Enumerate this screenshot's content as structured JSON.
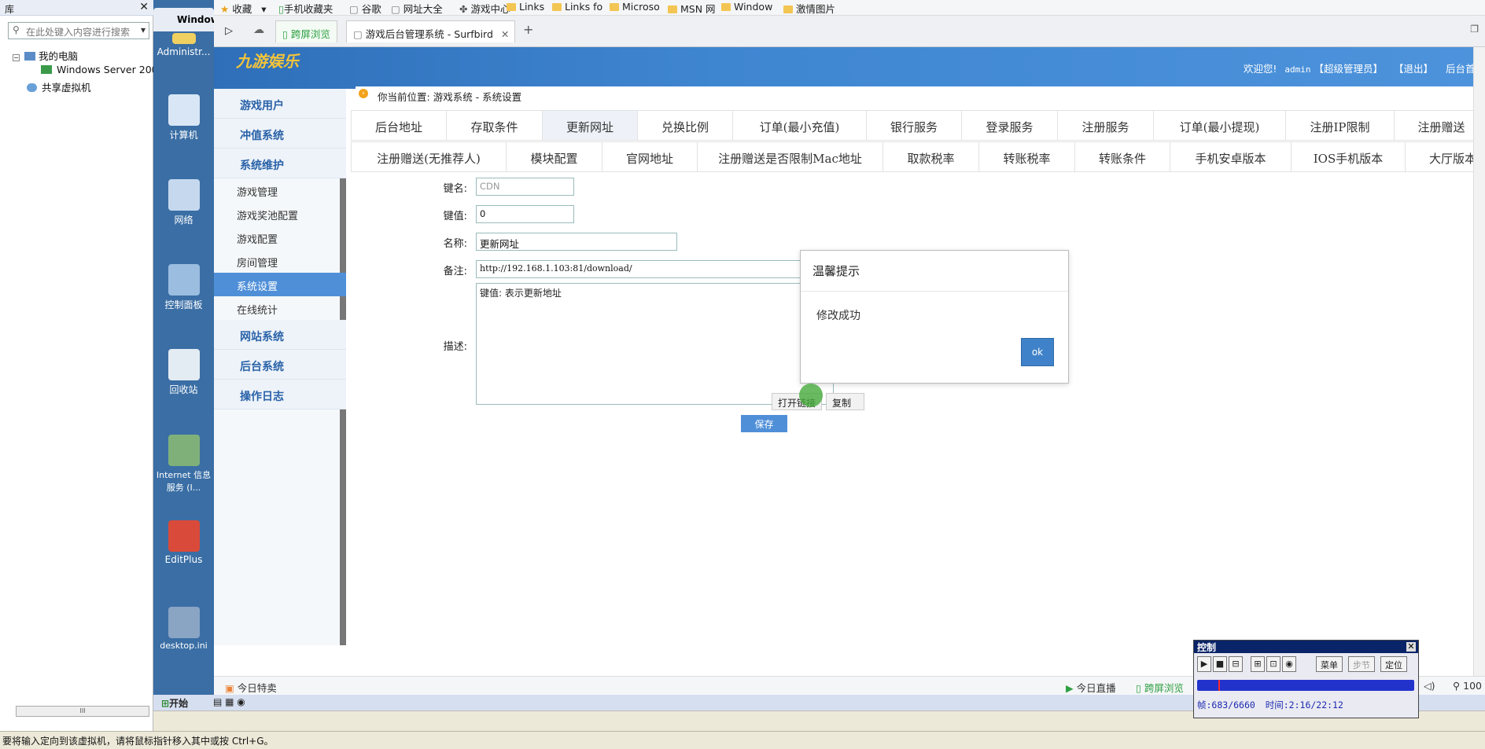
{
  "library": {
    "title": "库",
    "search_placeholder": "在此处键入内容进行搜索",
    "tree": [
      "我的电脑",
      "Windows Server 200",
      "共享虚拟机"
    ],
    "scroll_mark": "III"
  },
  "desktop": {
    "tab": "Window",
    "icons": [
      "Administr...",
      "计算机",
      "网络",
      "控制面板",
      "回收站",
      "Internet 信息服务 (I...",
      "EditPlus",
      "desktop.ini"
    ]
  },
  "bookmarks": [
    "收藏",
    "手机收藏夹",
    "谷歌",
    "网址大全",
    "游戏中心",
    "Links",
    "Links fo",
    "Microso",
    "MSN 网",
    "Window",
    "激情图片"
  ],
  "browser": {
    "tab_green": "跨屏浏览",
    "tab_active": "游戏后台管理系统 - Surfbird",
    "new_tab": "+"
  },
  "header": {
    "logo": "九游娱乐",
    "welcome": "欢迎您!",
    "user": "admin",
    "role": "【超级管理员】",
    "logout": "【退出】",
    "home": "后台首页"
  },
  "sidebar": {
    "groups": [
      "游戏用户",
      "冲值系统",
      "系统维护",
      "网站系统",
      "后台系统",
      "操作日志"
    ],
    "items": [
      "游戏管理",
      "游戏奖池配置",
      "游戏配置",
      "房间管理",
      "系统设置",
      "在线统计"
    ],
    "active_item": "系统设置"
  },
  "breadcrumb": {
    "prefix": "你当前位置:",
    "path": "游戏系统 - 系统设置"
  },
  "tabs_row1": [
    "后台地址",
    "存取条件",
    "更新网址",
    "兑换比例",
    "订单(最小充值)",
    "银行服务",
    "登录服务",
    "注册服务",
    "订单(最小提现)",
    "注册IP限制",
    "注册赠送"
  ],
  "tabs_row2": [
    "注册赠送(无推荐人)",
    "模块配置",
    "官网地址",
    "注册赠送是否限制Mac地址",
    "取款税率",
    "转账税率",
    "转账条件",
    "手机安卓版本",
    "IOS手机版本",
    "大厅版本号"
  ],
  "selected_tab": "更新网址",
  "form": {
    "key_label": "键名:",
    "key_value": "CDN",
    "val_label": "键值:",
    "val_value": "0",
    "name_label": "名称:",
    "name_value": "更新网址",
    "remark_label": "备注:",
    "remark_value": "http://192.168.1.103:81/download/",
    "desc_label": "描述:",
    "desc_value": "键值: 表示更新地址",
    "open_link": "打开链接",
    "copy": "复制",
    "save": "保存"
  },
  "dialog": {
    "title": "温馨提示",
    "message": "修改成功",
    "ok": "ok"
  },
  "browser_status": {
    "left": "今日特卖",
    "live": "今日直播",
    "cross": "跨屏浏览",
    "zoom": "100"
  },
  "taskbar": {
    "start": "开始"
  },
  "windows_status": "要将输入定向到该虚拟机，请将鼠标指针移入其中或按 Ctrl+G。",
  "control": {
    "title": "控制",
    "menu": "菜单",
    "step": "步节",
    "locate": "定位",
    "frame_label": "帧:683/6660",
    "time_label": "时间:2:16/22:12"
  }
}
